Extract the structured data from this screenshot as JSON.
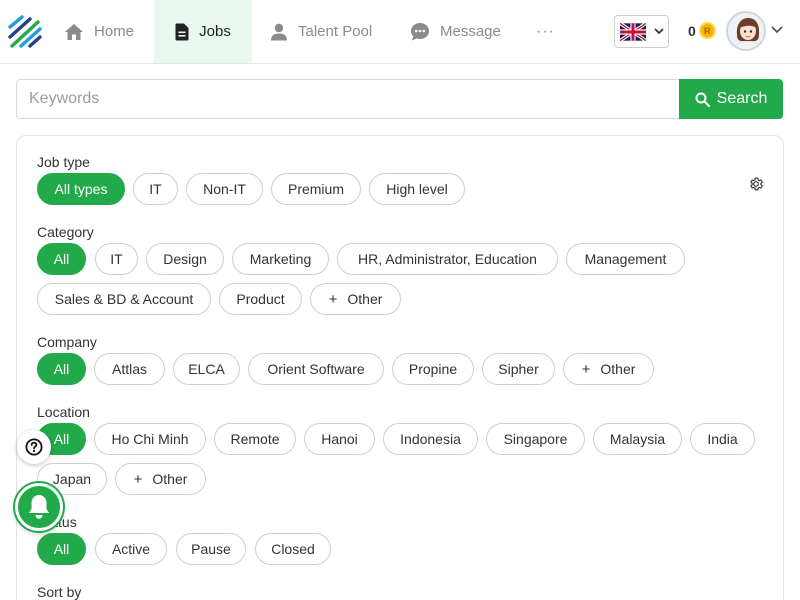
{
  "nav": {
    "home": "Home",
    "jobs": "Jobs",
    "talent_pool": "Talent Pool",
    "message": "Message",
    "more": "···"
  },
  "header": {
    "coins": "0",
    "coin_symbol": "R",
    "language": "English (UK flag)"
  },
  "search": {
    "placeholder": "Keywords",
    "value": "",
    "button": "Search"
  },
  "filters": {
    "job_type": {
      "label": "Job type",
      "options": [
        "All types",
        "IT",
        "Non-IT",
        "Premium",
        "High level"
      ],
      "selected": "All types"
    },
    "category": {
      "label": "Category",
      "options": [
        "All",
        "IT",
        "Design",
        "Marketing",
        "HR, Administrator, Education",
        "Management",
        "Sales & BD & Account",
        "Product",
        "Other"
      ],
      "selected": "All"
    },
    "company": {
      "label": "Company",
      "options": [
        "All",
        "Attlas",
        "ELCA",
        "Orient Software",
        "Propine",
        "Sipher",
        "Other"
      ],
      "selected": "All"
    },
    "location": {
      "label": "Location",
      "options": [
        "All",
        "Ho Chi Minh",
        "Remote",
        "Hanoi",
        "Indonesia",
        "Singapore",
        "Malaysia",
        "India",
        "Japan",
        "Other"
      ],
      "selected": "All"
    },
    "status": {
      "label": "Status",
      "options": [
        "All",
        "Active",
        "Pause",
        "Closed"
      ],
      "selected": "All"
    },
    "sort_by": {
      "label": "Sort by"
    }
  },
  "colors": {
    "accent": "#22a94a",
    "active_nav_bg": "#e9f7ee",
    "muted_text": "#8a8a8a",
    "border": "#cfcfcf"
  },
  "icons": {
    "logo": "stripes-logo",
    "home": "home-icon",
    "jobs": "document-icon",
    "talent_pool": "person-icon",
    "message": "chat-bubble-icon",
    "search": "search-icon",
    "settings": "gear-icon",
    "help": "question-icon",
    "notifications": "bell-icon"
  }
}
